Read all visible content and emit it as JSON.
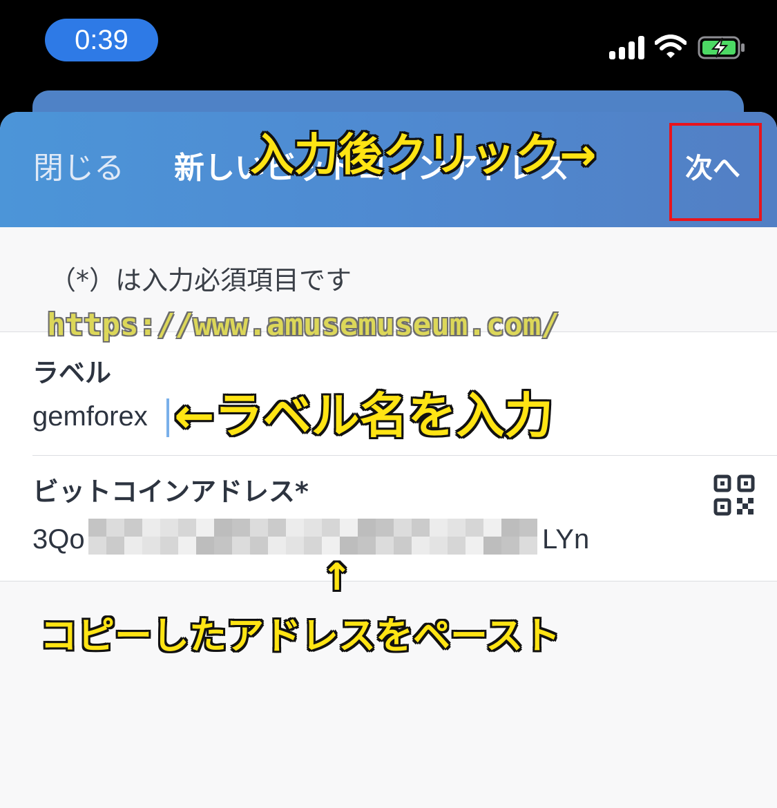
{
  "status_bar": {
    "time": "0:39"
  },
  "header": {
    "close_label": "閉じる",
    "title": "新しいビットコインアドレス",
    "next_label": "次へ"
  },
  "form": {
    "required_note": "（*）は入力必須項目です",
    "label_field": {
      "label": "ラベル",
      "value": "gemforex"
    },
    "address_field": {
      "label": "ビットコインアドレス*",
      "prefix": "3Qo",
      "suffix": "LYn",
      "masked": true
    }
  },
  "annotations": {
    "tap_next": "入力後クリック→",
    "watermark": "https://www.amusemuseum.com/",
    "label_hint": "←ラベル名を入力",
    "up_arrow": "↑",
    "paste_hint": "コピーしたアドレスをペースト"
  },
  "colors": {
    "header_blue": "#4f8ad1",
    "highlight_red": "#e8141c",
    "annotation_yellow": "#ffe414",
    "time_pill": "#2e7ae6",
    "battery_green": "#4cd964"
  }
}
